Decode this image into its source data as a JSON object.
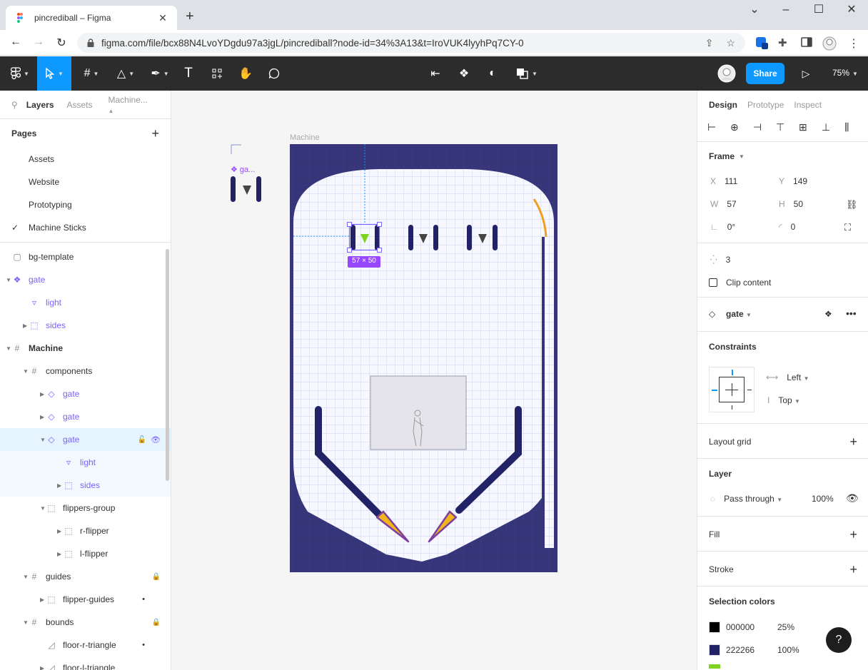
{
  "browser": {
    "tab_title": "pincrediball – Figma",
    "url": "figma.com/file/bcx88N4LvoYDgdu97a3jgL/pincrediball?node-id=34%3A13&t=IroVUK4lyyhPq7CY-0",
    "extension_badge": "1"
  },
  "toolbar": {
    "share_label": "Share",
    "zoom_label": "75%"
  },
  "left_panel": {
    "tabs": [
      "Layers",
      "Assets",
      "Machine..."
    ],
    "pages_heading": "Pages",
    "pages": [
      {
        "label": "Assets",
        "checked": false
      },
      {
        "label": "Website",
        "checked": false
      },
      {
        "label": "Prototyping",
        "checked": false
      },
      {
        "label": "Machine Sticks",
        "checked": true
      }
    ],
    "layers": [
      {
        "label": "bg-template",
        "icon": "rect-icon",
        "indent": 0,
        "arrow": "",
        "component": false
      },
      {
        "label": "gate",
        "icon": "component-main-icon",
        "indent": 0,
        "arrow": "down",
        "component": true
      },
      {
        "label": "light",
        "icon": "triangle-icon",
        "indent": 1,
        "arrow": "",
        "component": true
      },
      {
        "label": "sides",
        "icon": "group-icon",
        "indent": 1,
        "arrow": "right",
        "component": true
      },
      {
        "label": "Machine",
        "icon": "frame-icon",
        "indent": 0,
        "arrow": "down",
        "component": false,
        "bold": true
      },
      {
        "label": "components",
        "icon": "frame-icon",
        "indent": 1,
        "arrow": "down",
        "component": false
      },
      {
        "label": "gate",
        "icon": "instance-icon",
        "indent": 2,
        "arrow": "right",
        "component": true
      },
      {
        "label": "gate",
        "icon": "instance-icon",
        "indent": 2,
        "arrow": "right",
        "component": true
      },
      {
        "label": "gate",
        "icon": "instance-icon",
        "indent": 2,
        "arrow": "down",
        "component": true,
        "selected": true
      },
      {
        "label": "light",
        "icon": "triangle-icon",
        "indent": 3,
        "arrow": "",
        "component": true,
        "subselected": true
      },
      {
        "label": "sides",
        "icon": "group-icon",
        "indent": 3,
        "arrow": "right",
        "component": true,
        "subselected": true
      },
      {
        "label": "flippers-group",
        "icon": "group-icon",
        "indent": 2,
        "arrow": "down",
        "component": false
      },
      {
        "label": "r-flipper",
        "icon": "group-icon",
        "indent": 3,
        "arrow": "right",
        "component": false
      },
      {
        "label": "l-flipper",
        "icon": "group-icon",
        "indent": 3,
        "arrow": "right",
        "component": false
      },
      {
        "label": "guides",
        "icon": "frame-icon",
        "indent": 1,
        "arrow": "down",
        "component": false,
        "locked": true
      },
      {
        "label": "flipper-guides",
        "icon": "group-icon",
        "indent": 2,
        "arrow": "right",
        "component": false,
        "dot": true
      },
      {
        "label": "bounds",
        "icon": "frame-icon",
        "indent": 1,
        "arrow": "down",
        "component": false,
        "locked": true
      },
      {
        "label": "floor-r-triangle",
        "icon": "vector-icon",
        "indent": 2,
        "arrow": "",
        "component": false,
        "dot": true
      },
      {
        "label": "floor-l-triangle",
        "icon": "vector-icon",
        "indent": 2,
        "arrow": "right",
        "component": false
      }
    ]
  },
  "canvas": {
    "frame_label": "Machine",
    "floating_component_label": "ga...",
    "selection_size": "57 × 50"
  },
  "right_panel": {
    "tabs": [
      "Design",
      "Prototype",
      "Inspect"
    ],
    "frame_heading": "Frame",
    "x_label": "X",
    "x_value": "111",
    "y_label": "Y",
    "y_value": "149",
    "w_label": "W",
    "w_value": "57",
    "h_label": "H",
    "h_value": "50",
    "rotation": "0°",
    "radius": "0",
    "points": "3",
    "clip_content": "Clip content",
    "component_name": "gate",
    "constraints_heading": "Constraints",
    "constraint_h": "Left",
    "constraint_v": "Top",
    "layout_grid": "Layout grid",
    "layer_heading": "Layer",
    "blend_mode": "Pass through",
    "opacity": "100%",
    "fill": "Fill",
    "stroke": "Stroke",
    "selection_colors_heading": "Selection colors",
    "selection_colors": [
      {
        "hex": "000000",
        "opacity": "25%",
        "swatch": "#000000"
      },
      {
        "hex": "222266",
        "opacity": "100%",
        "swatch": "#222266"
      }
    ],
    "help_label": "?"
  },
  "colors": {
    "accent": "#0d99ff",
    "component": "#7b61ff",
    "machine_bg": "#36357a",
    "stick": "#222266",
    "flipper": "#f0b41c",
    "light": "#7ed321"
  }
}
